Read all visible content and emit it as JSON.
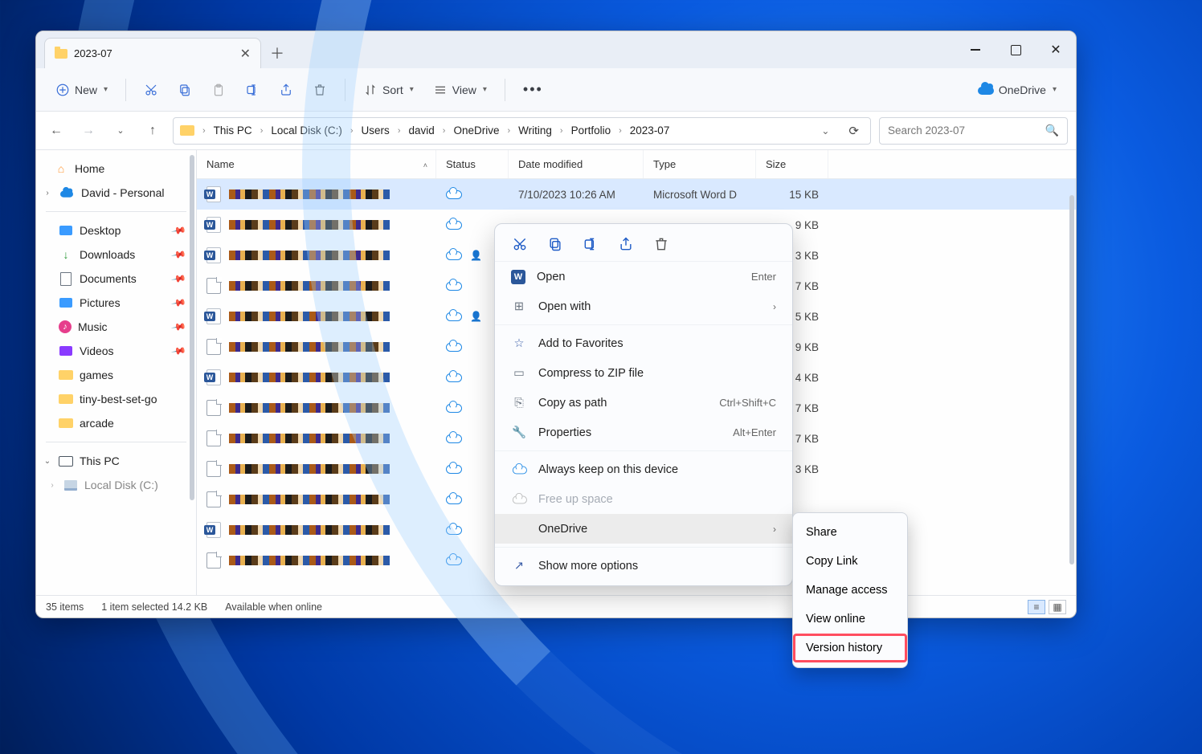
{
  "tab": {
    "title": "2023-07"
  },
  "toolbar": {
    "new": "New",
    "sort": "Sort",
    "view": "View",
    "onedrive": "OneDrive"
  },
  "breadcrumbs": [
    "This PC",
    "Local Disk (C:)",
    "Users",
    "david",
    "OneDrive",
    "Writing",
    "Portfolio",
    "2023-07"
  ],
  "search": {
    "placeholder": "Search 2023-07"
  },
  "sidebar": {
    "home": "Home",
    "personal": "David - Personal",
    "quick": [
      "Desktop",
      "Downloads",
      "Documents",
      "Pictures",
      "Music",
      "Videos",
      "games",
      "tiny-best-set-go",
      "arcade"
    ],
    "thispc": "This PC",
    "disk": "Local Disk (C:)"
  },
  "columns": {
    "name": "Name",
    "status": "Status",
    "date": "Date modified",
    "type": "Type",
    "size": "Size"
  },
  "selrow": {
    "date": "7/10/2023 10:26 AM",
    "type": "Microsoft Word D",
    "size": "15 KB"
  },
  "rows": [
    {
      "icon": "word",
      "status": "cloud",
      "size": "9 KB"
    },
    {
      "icon": "word",
      "status": "cloud-person",
      "size": "3 KB"
    },
    {
      "icon": "blank",
      "status": "cloud",
      "size": "7 KB"
    },
    {
      "icon": "word",
      "status": "cloud-person",
      "size": "5 KB"
    },
    {
      "icon": "blank",
      "status": "cloud",
      "size": "9 KB"
    },
    {
      "icon": "word",
      "status": "cloud",
      "size": "4 KB"
    },
    {
      "icon": "blank",
      "status": "cloud",
      "size": "7 KB"
    },
    {
      "icon": "blank",
      "status": "cloud",
      "size": "7 KB"
    },
    {
      "icon": "blank",
      "status": "cloud",
      "size": "3 KB"
    },
    {
      "icon": "blank",
      "status": "cloud",
      "size": ""
    },
    {
      "icon": "word",
      "status": "cloud",
      "size": ""
    },
    {
      "icon": "blank",
      "status": "cloud",
      "size": ""
    }
  ],
  "status": {
    "count": "35 items",
    "sel": "1 item selected  14.2 KB",
    "avail": "Available when online"
  },
  "ctx": {
    "open": "Open",
    "open_sc": "Enter",
    "openwith": "Open with",
    "fav": "Add to Favorites",
    "zip": "Compress to ZIP file",
    "copypath": "Copy as path",
    "copypath_sc": "Ctrl+Shift+C",
    "props": "Properties",
    "props_sc": "Alt+Enter",
    "keep": "Always keep on this device",
    "free": "Free up space",
    "onedrive": "OneDrive",
    "more": "Show more options"
  },
  "submenu": [
    "Share",
    "Copy Link",
    "Manage access",
    "View online",
    "Version history"
  ]
}
